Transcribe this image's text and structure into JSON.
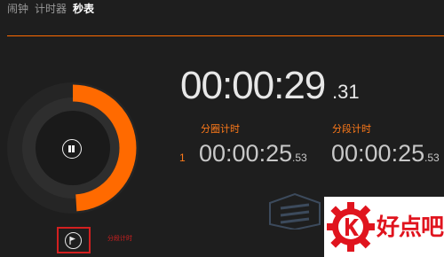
{
  "tabs": [
    {
      "label": "闹钟",
      "active": false
    },
    {
      "label": "计时器",
      "active": false
    },
    {
      "label": "秒表",
      "active": true
    }
  ],
  "accent_color": "#ff6a00",
  "stopwatch": {
    "main_time": "00:00:29",
    "main_fraction": ".31",
    "dial_progress": 0.49,
    "pause_icon": "pause-icon",
    "flag_icon": "flag-icon"
  },
  "laps": {
    "lap_label": "分圈计时",
    "split_label": "分段计时",
    "rows": [
      {
        "number": "1",
        "lap_time": "00:00:25",
        "lap_fraction": ".53",
        "split_time": "00:00:25",
        "split_fraction": ".53"
      }
    ]
  },
  "annotation": {
    "text": "分段计时",
    "color": "#d32020"
  },
  "watermark": {
    "text": "好点吧"
  }
}
